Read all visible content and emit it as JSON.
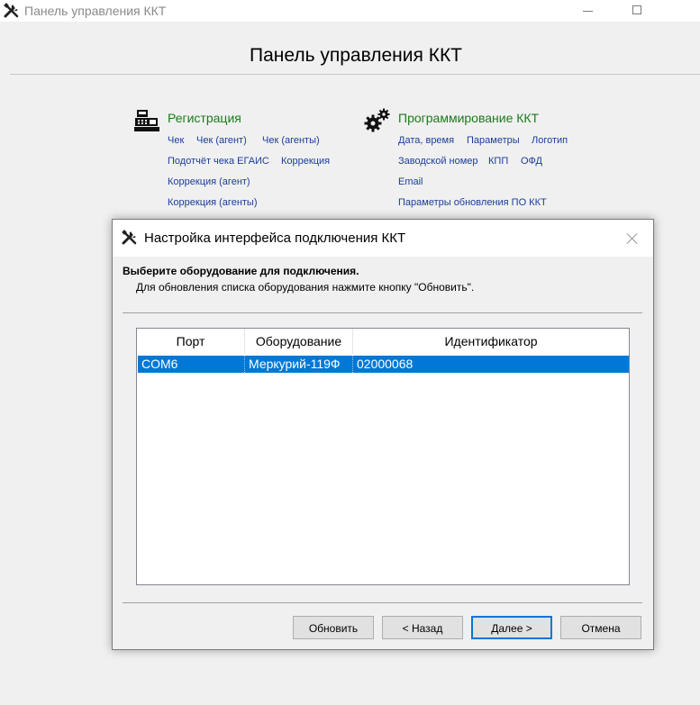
{
  "window": {
    "title": "Панель управления ККТ",
    "app_icon": "tools-icon"
  },
  "main": {
    "heading": "Панель управления ККТ",
    "registration": {
      "icon": "cash-register-icon",
      "title": "Регистрация",
      "links": [
        "Чек",
        "Чек (агент)",
        "Чек (агенты)",
        "Подотчёт чека ЕГАИС",
        "Коррекция",
        "Коррекция (агент)",
        "Коррекция (агенты)"
      ]
    },
    "programming": {
      "icon": "gears-icon",
      "title": "Программирование ККТ",
      "links": [
        "Дата, время",
        "Параметры",
        "Логотип",
        "Заводской номер",
        "КПП",
        "ОФД",
        "Email",
        "Параметры обновления ПО ККТ"
      ]
    }
  },
  "dialog": {
    "icon": "tools-icon",
    "title": "Настройка интерфейса подключения ККТ",
    "heading": "Выберите оборудование  для подключения.",
    "subheading": "Для обновления списка оборудования нажмите кнопку \"Обновить\".",
    "table": {
      "columns": [
        "Порт",
        "Оборудование",
        "Идентификатор"
      ],
      "rows": [
        {
          "port": "COM6",
          "device": "Меркурий-119Ф",
          "id": "02000068",
          "selected": true
        }
      ]
    },
    "buttons": {
      "refresh": "Обновить",
      "back": "< Назад",
      "next": "Далее >",
      "cancel": "Отмена"
    }
  }
}
